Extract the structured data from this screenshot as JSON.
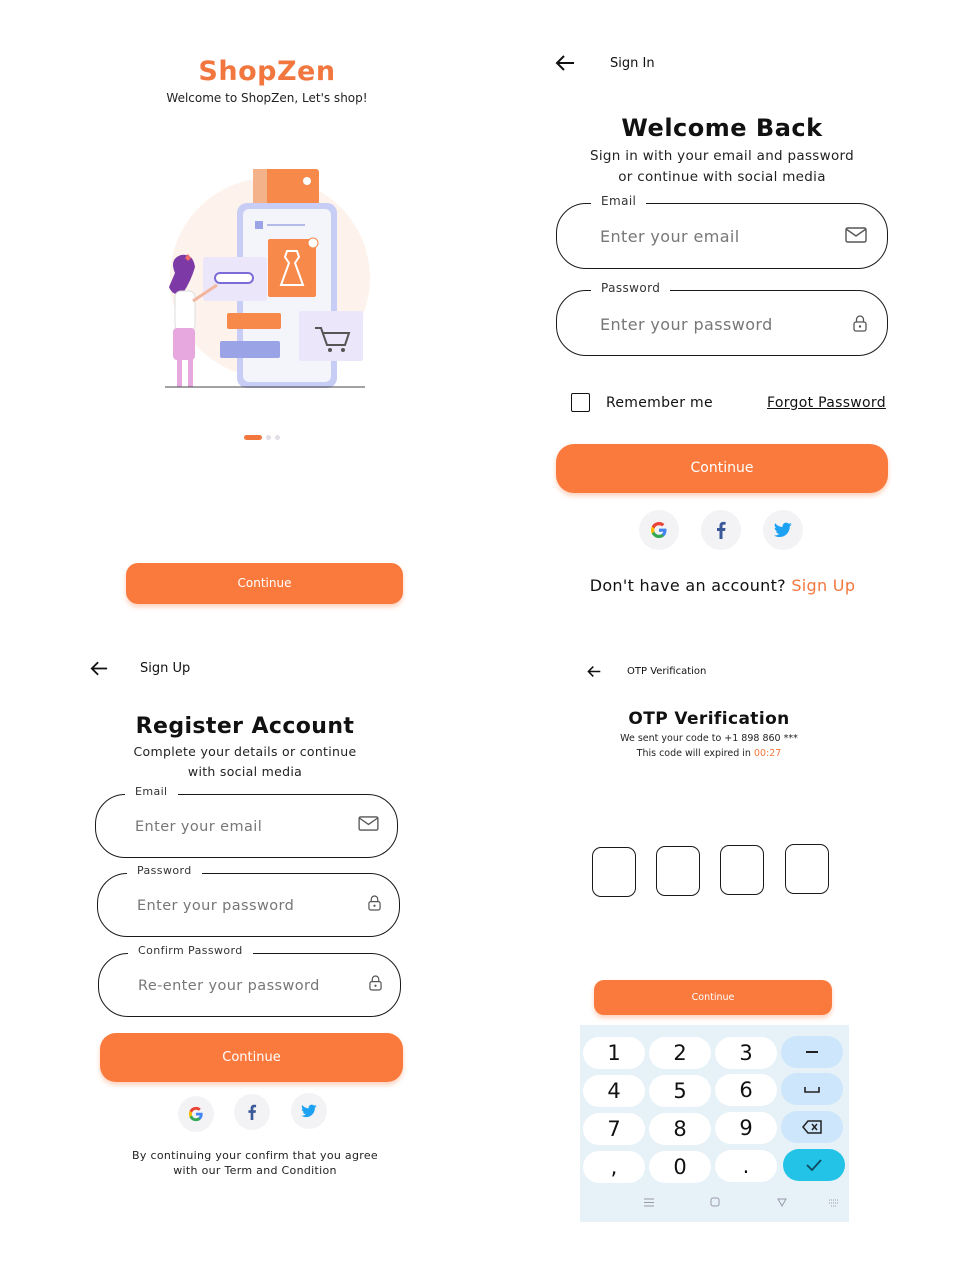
{
  "colors": {
    "accent": "#fa7a3e",
    "brand": "#f2773e",
    "keypad_bg": "#e6f1f8",
    "keypad_done": "#22c3e6"
  },
  "splash": {
    "brand": "ShopZen",
    "subtitle": "Welcome to ShopZen, Let's shop!",
    "page_indicator": {
      "count": 3,
      "active": 1
    },
    "continue_label": "Continue"
  },
  "signin": {
    "header_title": "Sign In",
    "heading": "Welcome Back",
    "description_line1": "Sign in with your email and password",
    "description_line2": "or continue with social media",
    "email": {
      "label": "Email",
      "placeholder": "Enter your email",
      "icon": "mail-icon"
    },
    "password": {
      "label": "Password",
      "placeholder": "Enter your password",
      "icon": "lock-icon"
    },
    "remember_label": "Remember me",
    "remember_checked": false,
    "forgot_label": "Forgot Password",
    "continue_label": "Continue",
    "social": [
      "google-icon",
      "facebook-icon",
      "twitter-icon"
    ],
    "no_account_text": "Don't have an account?",
    "signup_link": "Sign Up"
  },
  "signup": {
    "header_title": "Sign Up",
    "heading": "Register Account",
    "description_line1": "Complete your details or continue",
    "description_line2": "with social media",
    "email": {
      "label": "Email",
      "placeholder": "Enter your email",
      "icon": "mail-icon"
    },
    "password": {
      "label": "Password",
      "placeholder": "Enter your password",
      "icon": "lock-icon"
    },
    "confirm_password": {
      "label": "Confirm Password",
      "placeholder": "Re-enter your password",
      "icon": "lock-icon"
    },
    "continue_label": "Continue",
    "social": [
      "google-icon",
      "facebook-icon",
      "twitter-icon"
    ],
    "terms_line1": "By continuing your confirm that you agree",
    "terms_line2": "with our Term and Condition"
  },
  "otp": {
    "header_title": "OTP Verification",
    "heading": "OTP Verification",
    "sent_text": "We sent your code to +1 898 860 ***",
    "expire_text": "This code will expired in",
    "timer": "00:27",
    "digits": [
      "",
      "",
      "",
      ""
    ],
    "continue_label": "Continue",
    "keypad": {
      "keys": [
        "1",
        "2",
        "3",
        "4",
        "5",
        "6",
        "7",
        "8",
        "9",
        ",",
        "0",
        "."
      ],
      "action_keys": [
        "minus-key",
        "space-key",
        "backspace-icon",
        "done-check-icon"
      ],
      "nav_keys": [
        "menu-icon",
        "home-icon",
        "back-triangle-icon",
        "keyboard-icon"
      ]
    }
  }
}
